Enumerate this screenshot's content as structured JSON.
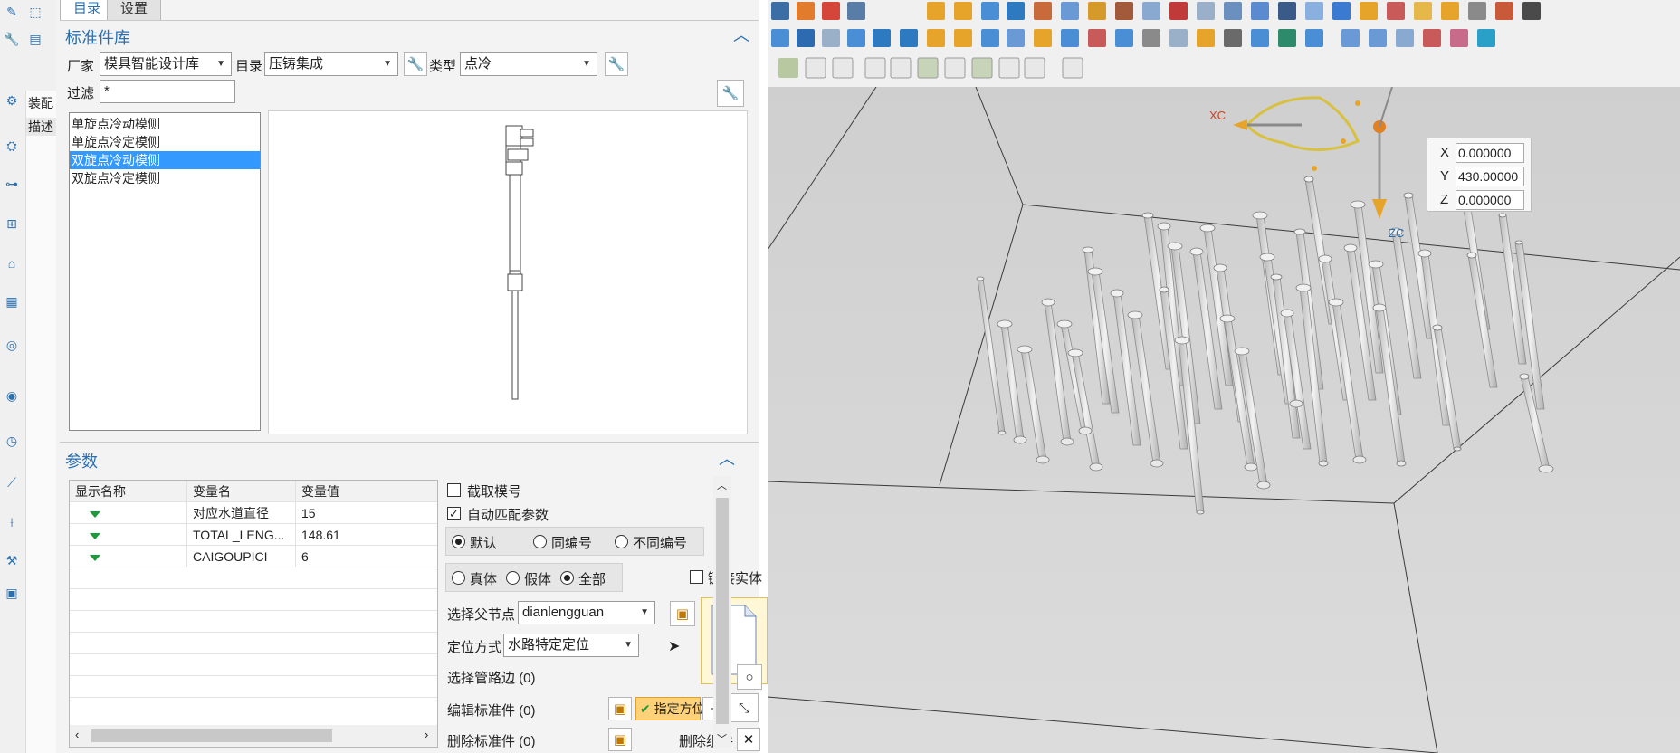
{
  "dialog": {
    "tabs": [
      "目录",
      "设置"
    ],
    "library_title": "标准件库",
    "vendor_label": "厂家",
    "vendor_value": "模具智能设计库",
    "catalog_label": "目录",
    "catalog_value": "压铸集成",
    "type_label": "类型",
    "type_value": "点冷",
    "filter_label": "过滤",
    "filter_value": "*",
    "parts": [
      {
        "label": "单旋点冷动模侧",
        "selected": false
      },
      {
        "label": "单旋点冷定模侧",
        "selected": false
      },
      {
        "label": "双旋点冷动模侧",
        "selected": true
      },
      {
        "label": "双旋点冷定模侧",
        "selected": false
      }
    ],
    "params_title": "参数",
    "table_headers": [
      "显示名称",
      "变量名",
      "变量值"
    ],
    "table_rows": [
      {
        "var": "对应水道直径",
        "value": "15"
      },
      {
        "var": "TOTAL_LENG...",
        "value": "148.61"
      },
      {
        "var": "CAIGOUPICI",
        "value": "6"
      }
    ],
    "options": {
      "cut_mold_number": "截取模号",
      "auto_match": "自动匹配参数",
      "numbering": [
        "默认",
        "同编号",
        "不同编号"
      ],
      "body_type": [
        "真体",
        "假体",
        "全部"
      ],
      "link_solid": "链接实体",
      "parent_node_label": "选择父节点",
      "parent_node_value": "dianlengguan",
      "position_label": "定位方式",
      "position_value": "水路特定定位",
      "pipe_edge_label": "选择管路边 (0)",
      "edit_std_label": "编辑标准件 (0)",
      "specify_orient": "指定方位",
      "delete_std_label": "删除标准件 (0)",
      "delete_component": "删除组件"
    }
  },
  "viewport": {
    "coords": [
      {
        "axis": "X",
        "value": "0.000000"
      },
      {
        "axis": "Y",
        "value": "430.00000"
      },
      {
        "axis": "Z",
        "value": "0.000000"
      }
    ],
    "axis_labels": {
      "xc": "XC",
      "zc": "ZC"
    }
  },
  "colors": {
    "accent": "#2a6fb0",
    "selection": "#3399ff",
    "viewport_bg": "#d4d4d4",
    "highlight_button": "#ffd27a"
  }
}
